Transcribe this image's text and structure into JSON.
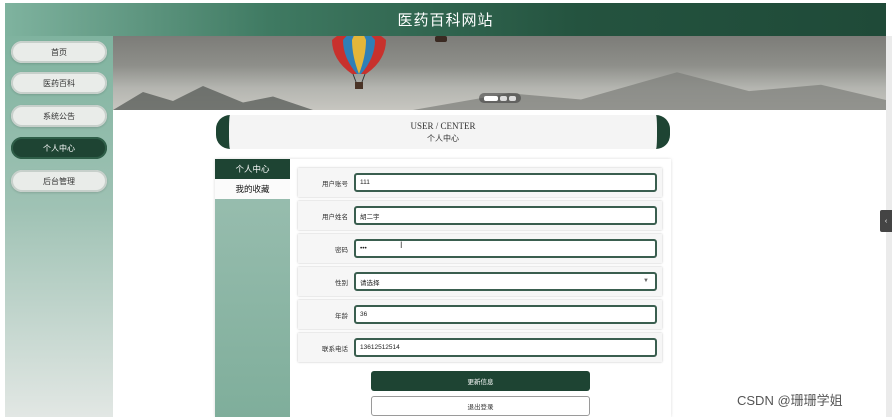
{
  "header": {
    "title": "医药百科网站"
  },
  "sidebar": {
    "items": [
      {
        "label": "首页",
        "active": false
      },
      {
        "label": "医药百科",
        "active": false
      },
      {
        "label": "系统公告",
        "active": false
      },
      {
        "label": "个人中心",
        "active": true
      },
      {
        "label": "后台管理",
        "active": false
      }
    ]
  },
  "carousel": {
    "slide_count": 3,
    "active_index": 0
  },
  "section": {
    "title_en": "USER / CENTER",
    "title_cn": "个人中心"
  },
  "user_menu": {
    "items": [
      "个人中心",
      "我的收藏"
    ],
    "active_index": 0
  },
  "form": {
    "fields": [
      {
        "label": "用户账号",
        "value": "111"
      },
      {
        "label": "用户姓名",
        "value": "胡二宇"
      },
      {
        "label": "密码",
        "value": "•••"
      },
      {
        "label": "性别",
        "value": "请选择"
      },
      {
        "label": "年龄",
        "value": "36"
      },
      {
        "label": "联系电话",
        "value": "13612512514"
      }
    ],
    "update_button": "更新信息",
    "logout_button": "退出登录"
  },
  "watermark": "CSDN @珊珊学姐",
  "colors": {
    "primary": "#1e4433",
    "accent": "#7fb39f"
  }
}
